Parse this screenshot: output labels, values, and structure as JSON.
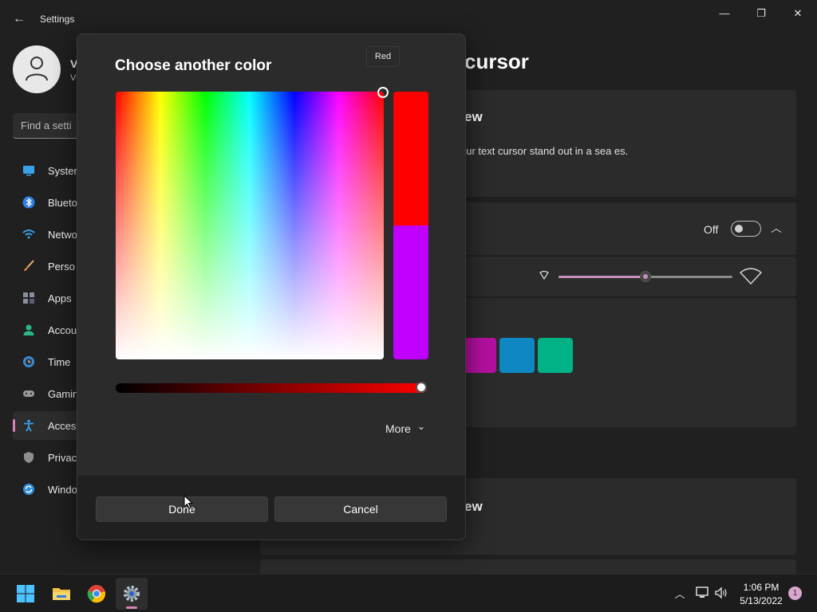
{
  "window": {
    "title": "Settings",
    "back_glyph": "←",
    "minimize_glyph": "—",
    "maximize_glyph": "❐",
    "close_glyph": "✕"
  },
  "user": {
    "name": "V",
    "sub": "V"
  },
  "search": {
    "placeholder": "Find a setti"
  },
  "sidebar": {
    "items": [
      {
        "label": "Syster",
        "icon": "system-icon"
      },
      {
        "label": "Blueto",
        "icon": "bluetooth-icon"
      },
      {
        "label": "Netwo",
        "icon": "wifi-icon"
      },
      {
        "label": "Perso",
        "icon": "brush-icon"
      },
      {
        "label": "Apps",
        "icon": "apps-icon"
      },
      {
        "label": "Accou",
        "icon": "account-icon"
      },
      {
        "label": "Time",
        "icon": "clock-globe-icon"
      },
      {
        "label": "Gamin",
        "icon": "gamepad-icon"
      },
      {
        "label": "Acces",
        "icon": "accessibility-icon",
        "active": true
      },
      {
        "label": "Privac",
        "icon": "shield-icon"
      },
      {
        "label": "Windo",
        "icon": "update-icon"
      }
    ]
  },
  "main": {
    "page_title": "cursor",
    "preview_card": {
      "title": "ew",
      "description": "our text cursor stand out in a sea es."
    },
    "indicator_card": {
      "toggle_label": "Off",
      "toggle_on": false
    },
    "size_slider": {
      "value": 0.5
    },
    "color_swatches": [
      "#b4109f",
      "#0e87c3",
      "#00b286"
    ],
    "preview_card2": {
      "title": "ew"
    }
  },
  "dialog": {
    "title": "Choose another color",
    "tooltip": "Red",
    "new_color": "#ff0000",
    "old_color": "#bf00ff",
    "value_slider": 1.0,
    "more_label": "More",
    "more_chevron": "⌄",
    "done_label": "Done",
    "cancel_label": "Cancel"
  },
  "taskbar": {
    "apps": [
      "windows-start-icon",
      "file-explorer-icon",
      "chrome-icon",
      "settings-gear-icon"
    ],
    "time": "1:06 PM",
    "date": "5/13/2022",
    "notification_count": "1",
    "tray_up_glyph": "︿"
  },
  "colors": {
    "accent": "#d882b8",
    "toggle_border": "#bdbdbd"
  }
}
